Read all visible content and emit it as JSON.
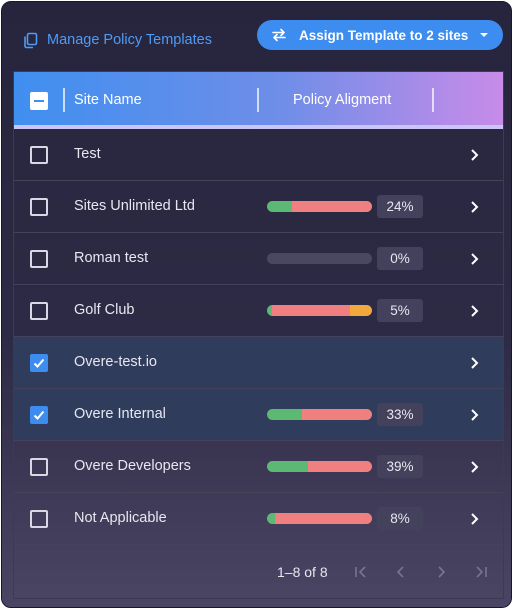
{
  "header": {
    "manage_label": "Manage Policy Templates",
    "assign_label": "Assign Template to 2 sites"
  },
  "table": {
    "columns": {
      "site": "Site Name",
      "policy": "Policy Aligment"
    },
    "rows": [
      {
        "name": "Test",
        "selected": false,
        "pct": null,
        "segments": []
      },
      {
        "name": "Sites Unlimited Ltd",
        "selected": false,
        "pct": "24%",
        "segments": [
          {
            "color": "#5cb974",
            "value": 24
          },
          {
            "color": "#f08080",
            "value": 76
          }
        ]
      },
      {
        "name": "Roman test",
        "selected": false,
        "pct": "0%",
        "segments": []
      },
      {
        "name": "Golf Club",
        "selected": false,
        "pct": "5%",
        "segments": [
          {
            "color": "#5cb974",
            "value": 5
          },
          {
            "color": "#f08080",
            "value": 74
          },
          {
            "color": "#f2a93b",
            "value": 21
          }
        ]
      },
      {
        "name": "Overe-test.io",
        "selected": true,
        "pct": null,
        "segments": []
      },
      {
        "name": "Overe Internal",
        "selected": true,
        "pct": "33%",
        "segments": [
          {
            "color": "#5cb974",
            "value": 33
          },
          {
            "color": "#f08080",
            "value": 67
          }
        ]
      },
      {
        "name": "Overe Developers",
        "selected": false,
        "pct": "39%",
        "segments": [
          {
            "color": "#5cb974",
            "value": 39
          },
          {
            "color": "#f08080",
            "value": 61
          }
        ]
      },
      {
        "name": "Not Applicable",
        "selected": false,
        "pct": "8%",
        "segments": [
          {
            "color": "#5cb974",
            "value": 8
          },
          {
            "color": "#f08080",
            "value": 92
          }
        ]
      }
    ]
  },
  "pagination": {
    "range": "1–8 of 8"
  },
  "colors": {
    "accent": "#3d8df0",
    "link": "#4e9bf5",
    "aligned": "#5cb974",
    "misaligned": "#f08080",
    "warning": "#f2a93b"
  },
  "icons": {
    "manage": "template-copy-icon",
    "assign": "swap-arrows-icon",
    "dropdown": "caret-down-icon",
    "row_open": "chevron-right-icon",
    "first": "first-page-icon",
    "prev": "chevron-left-icon",
    "next": "chevron-right-icon",
    "last": "last-page-icon"
  }
}
